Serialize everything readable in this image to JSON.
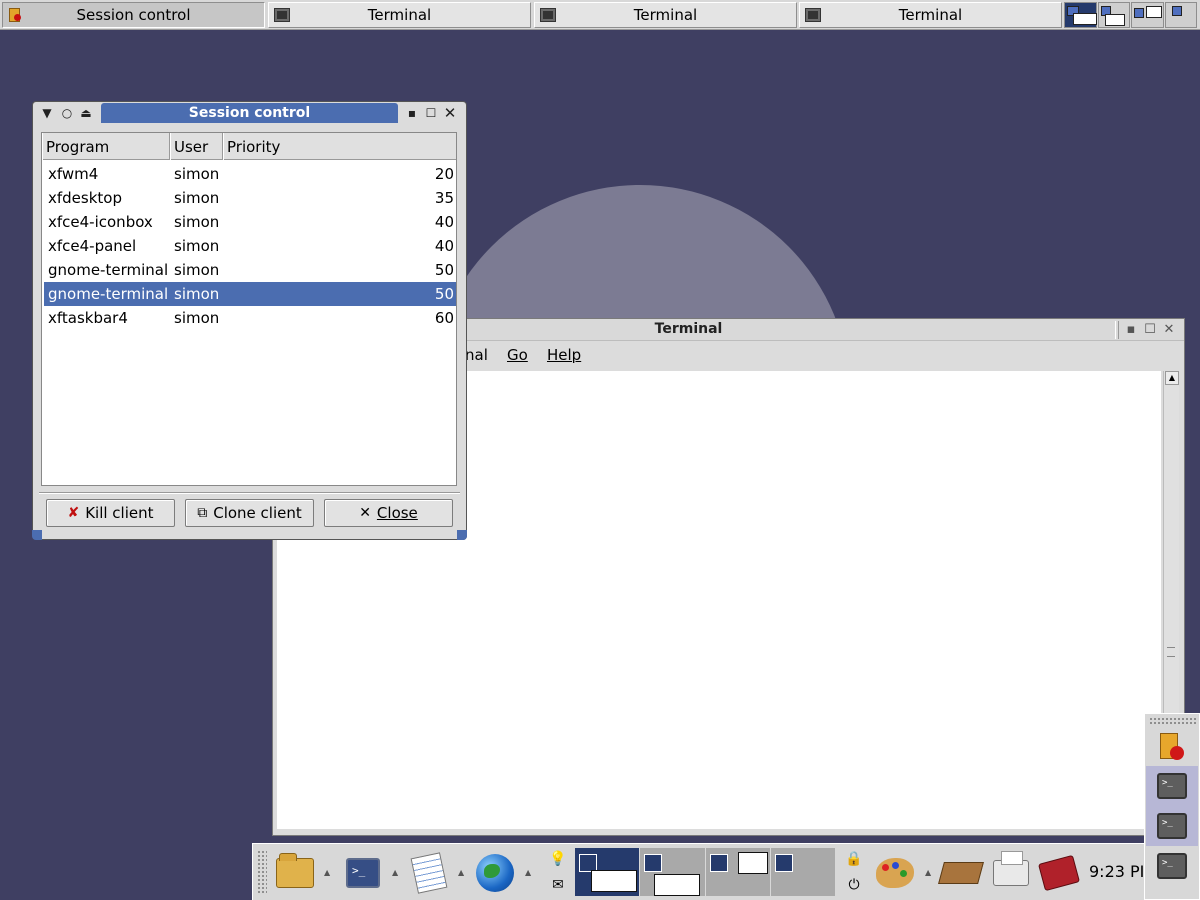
{
  "taskbar": {
    "tasks": [
      {
        "label": "Session control",
        "icon": "session-icon",
        "active": true
      },
      {
        "label": "Terminal",
        "icon": "terminal-icon",
        "active": false
      },
      {
        "label": "Terminal",
        "icon": "terminal-icon",
        "active": false
      },
      {
        "label": "Terminal",
        "icon": "terminal-icon",
        "active": false
      }
    ],
    "pager_active_workspace": 1
  },
  "terminal_window": {
    "title": "Terminal",
    "menu": {
      "partial": "nal",
      "go": "Go",
      "help": "Help"
    }
  },
  "session_window": {
    "title": "Session control",
    "columns": {
      "program": "Program",
      "user": "User",
      "priority": "Priority"
    },
    "rows": [
      {
        "program": "xfwm4",
        "user": "simon",
        "priority": "20",
        "selected": false
      },
      {
        "program": "xfdesktop",
        "user": "simon",
        "priority": "35",
        "selected": false
      },
      {
        "program": "xfce4-iconbox",
        "user": "simon",
        "priority": "40",
        "selected": false
      },
      {
        "program": "xfce4-panel",
        "user": "simon",
        "priority": "40",
        "selected": false
      },
      {
        "program": "gnome-terminal",
        "user": "simon",
        "priority": "50",
        "selected": false
      },
      {
        "program": "gnome-terminal",
        "user": "simon",
        "priority": "50",
        "selected": true
      },
      {
        "program": "xftaskbar4",
        "user": "simon",
        "priority": "60",
        "selected": false
      }
    ],
    "buttons": {
      "kill": "Kill client",
      "clone": "Clone client",
      "close": "Close"
    }
  },
  "panel": {
    "clock": "9:23 PI",
    "launchers": [
      "folder-icon",
      "terminal-launcher-icon",
      "text-editor-icon",
      "web-browser-icon",
      "palette-icon",
      "tray-icon",
      "printer-icon",
      "book-icon"
    ]
  },
  "dock": {
    "items": [
      "session-icon",
      "terminal-icon",
      "terminal-icon",
      "terminal-icon"
    ]
  },
  "colors": {
    "desktop": "#3f3f62",
    "selection": "#4b6db0",
    "window_bg": "#dcdcdc"
  }
}
